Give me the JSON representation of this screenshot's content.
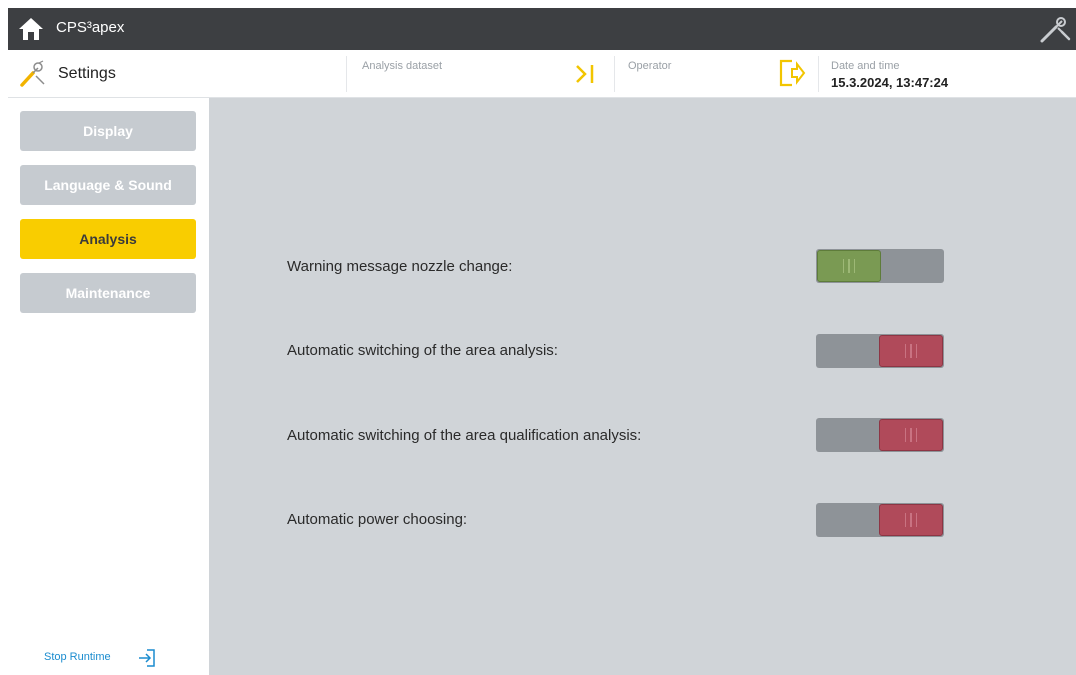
{
  "app": {
    "title": "CPS³apex"
  },
  "header": {
    "page_title": "Settings",
    "analysis_dataset_label": "Analysis dataset",
    "operator_label": "Operator",
    "datetime_label": "Date and time",
    "datetime_value": "15.3.2024, 13:47:24"
  },
  "sidebar": {
    "items": [
      {
        "label": "Display",
        "active": false
      },
      {
        "label": "Language & Sound",
        "active": false
      },
      {
        "label": "Analysis",
        "active": true
      },
      {
        "label": "Maintenance",
        "active": false
      }
    ],
    "stop_runtime_label": "Stop Runtime"
  },
  "settings": [
    {
      "label": "Warning message nozzle change:",
      "enabled": true
    },
    {
      "label": "Automatic switching of the area analysis:",
      "enabled": false
    },
    {
      "label": "Automatic switching of the area qualification analysis:",
      "enabled": false
    },
    {
      "label": "Automatic power choosing:",
      "enabled": false
    }
  ],
  "colors": {
    "accent": "#f9cd00",
    "toggle_on": "#7a9a53",
    "toggle_off": "#b04a5a",
    "titlebar": "#3d3f42",
    "panel": "#d0d4d8"
  },
  "icons": {
    "home": "home-icon",
    "tools": "tools-icon",
    "settings": "settings-icon",
    "skip": "skip-end-icon",
    "logout": "logout-icon",
    "stop_runtime": "exit-icon"
  }
}
